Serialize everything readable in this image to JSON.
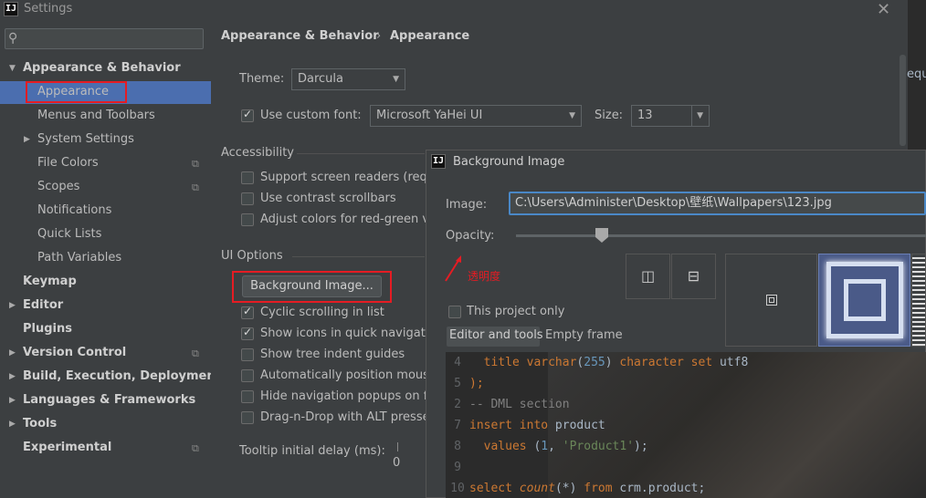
{
  "window": {
    "title": "Settings",
    "icon": "intellij-icon"
  },
  "search": {
    "placeholder": ""
  },
  "sidebar": {
    "items": [
      {
        "label": "Appearance & Behavior",
        "bold": true,
        "arrow": "▼"
      },
      {
        "label": "Appearance",
        "selected": true
      },
      {
        "label": "Menus and Toolbars"
      },
      {
        "label": "System Settings",
        "arrow": "▶"
      },
      {
        "label": "File Colors"
      },
      {
        "label": "Scopes"
      },
      {
        "label": "Notifications"
      },
      {
        "label": "Quick Lists"
      },
      {
        "label": "Path Variables"
      },
      {
        "label": "Keymap",
        "bold": true
      },
      {
        "label": "Editor",
        "bold": true,
        "arrow": "▶"
      },
      {
        "label": "Plugins",
        "bold": true
      },
      {
        "label": "Version Control",
        "bold": true,
        "arrow": "▶"
      },
      {
        "label": "Build, Execution, Deployment",
        "bold": true,
        "arrow": "▶"
      },
      {
        "label": "Languages & Frameworks",
        "bold": true,
        "arrow": "▶"
      },
      {
        "label": "Tools",
        "bold": true,
        "arrow": "▶"
      },
      {
        "label": "Experimental",
        "bold": true
      }
    ]
  },
  "breadcrumb": {
    "parent": "Appearance & Behavior",
    "sep": "›",
    "current": "Appearance"
  },
  "theme": {
    "label": "Theme:",
    "value": "Darcula"
  },
  "font": {
    "checkbox_label": "Use custom font:",
    "value": "Microsoft YaHei UI",
    "size_label": "Size:",
    "size_value": "13"
  },
  "accessibility": {
    "title": "Accessibility",
    "items": [
      "Support screen readers (requ",
      "Use contrast scrollbars",
      "Adjust colors for red-green vi"
    ]
  },
  "ui_options": {
    "title": "UI Options",
    "bg_button": "Background Image...",
    "items": [
      {
        "label": "Cyclic scrolling in list",
        "checked": true
      },
      {
        "label": "Show icons in quick navigatio",
        "checked": true
      },
      {
        "label": "Show tree indent guides",
        "checked": false
      },
      {
        "label": "Automatically position mouse",
        "checked": false
      },
      {
        "label": "Hide navigation popups on fo",
        "checked": false
      },
      {
        "label": "Drag-n-Drop with ALT presse",
        "checked": false
      }
    ],
    "tooltip_label": "Tooltip initial delay (ms):",
    "tooltip_value": "0"
  },
  "right_edge_text": "equ",
  "dialog": {
    "title": "Background Image",
    "image_label": "Image:",
    "image_path": "C:\\Users\\Administer\\Desktop\\壁纸\\Wallpapers\\123.jpg",
    "opacity_label": "Opacity:",
    "opacity_fraction": 0.21,
    "annotation": "透明度",
    "project_only": "This project only",
    "tabs": [
      "Editor and tools",
      "Empty frame"
    ]
  },
  "code_lines": [
    {
      "n": "4",
      "html": "  <span class='kw'>title</span> <span class='kw'>varchar</span>(<span class='num'>255</span>) <span class='kw'>character</span> <span class='kw'>set</span> utf8"
    },
    {
      "n": "5",
      "html": "<span class='kw'>);</span>"
    },
    {
      "n": "2",
      "html": "<span class='cm'>-- DML section</span>"
    },
    {
      "n": "7",
      "html": "<span class='kw'>insert</span> <span class='kw'>into</span> product"
    },
    {
      "n": "8",
      "html": "  <span class='kw'>values</span> (<span class='num'>1</span>, <span class='str'>'Product1'</span>);"
    },
    {
      "n": "9",
      "html": ""
    },
    {
      "n": "10",
      "html": "<span class='kw'>select</span> <span class='it'>count</span>(*) <span class='kw'>from</span> crm.product;"
    }
  ],
  "colors": {
    "selection": "#4b6eaf",
    "annotation_red": "#e51c23",
    "accent": "#4a88c7"
  }
}
